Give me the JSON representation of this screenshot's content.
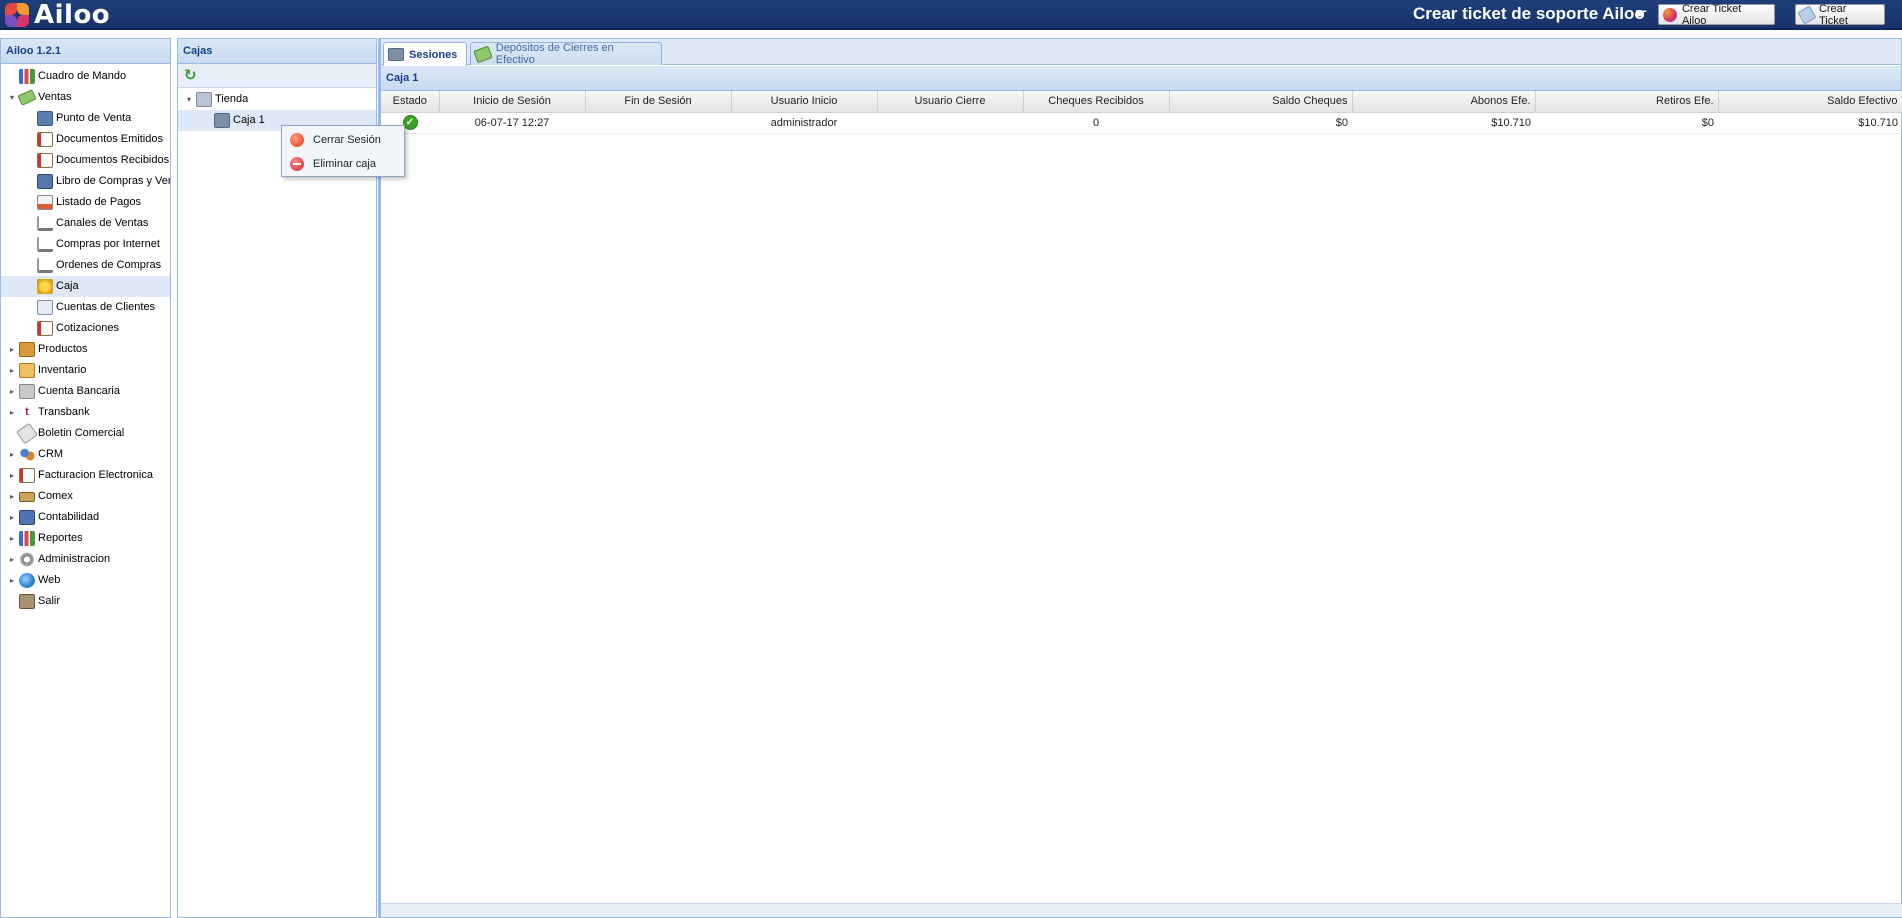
{
  "app": {
    "brand": "Ailoo"
  },
  "header": {
    "support_title": "Crear ticket de soporte Ailoo",
    "pointer_icon": "pointing-hand-icon",
    "btn_ticket_ailoo": "Crear Ticket Ailoo",
    "btn_ticket": "Crear Ticket"
  },
  "nav": {
    "title": "Ailoo 1.2.1",
    "items": [
      {
        "label": "Cuadro de Mando",
        "level": 0,
        "expander": "",
        "icon": "chart-icon"
      },
      {
        "label": "Ventas",
        "level": 0,
        "expander": "▾",
        "icon": "money-icon"
      },
      {
        "label": "Punto de Venta",
        "level": 1,
        "expander": "",
        "icon": "pos-icon"
      },
      {
        "label": "Documentos Emitidos",
        "level": 1,
        "expander": "",
        "icon": "document-icon"
      },
      {
        "label": "Documentos Recibidos",
        "level": 1,
        "expander": "",
        "icon": "document-icon"
      },
      {
        "label": "Libro de Compras y Ventas",
        "level": 1,
        "expander": "",
        "icon": "book-icon"
      },
      {
        "label": "Listado de Pagos",
        "level": 1,
        "expander": "",
        "icon": "payment-list-icon"
      },
      {
        "label": "Canales de Ventas",
        "level": 1,
        "expander": "",
        "icon": "cart-icon"
      },
      {
        "label": "Compras por Internet",
        "level": 1,
        "expander": "",
        "icon": "cart-icon"
      },
      {
        "label": "Ordenes de Compras",
        "level": 1,
        "expander": "",
        "icon": "cart-icon"
      },
      {
        "label": "Caja",
        "level": 1,
        "expander": "",
        "icon": "coins-icon",
        "selected": true
      },
      {
        "label": "Cuentas de Clientes",
        "level": 1,
        "expander": "",
        "icon": "client-card-icon"
      },
      {
        "label": "Cotizaciones",
        "level": 1,
        "expander": "",
        "icon": "document-icon"
      },
      {
        "label": "Productos",
        "level": 0,
        "expander": "▸",
        "icon": "box-icon"
      },
      {
        "label": "Inventario",
        "level": 0,
        "expander": "▸",
        "icon": "package-icon"
      },
      {
        "label": "Cuenta Bancaria",
        "level": 0,
        "expander": "▸",
        "icon": "bank-icon"
      },
      {
        "label": "Transbank",
        "level": 0,
        "expander": "▸",
        "icon": "transbank-icon"
      },
      {
        "label": "Boletin Comercial",
        "level": 0,
        "expander": "",
        "icon": "tag-icon"
      },
      {
        "label": "CRM",
        "level": 0,
        "expander": "▸",
        "icon": "users-icon"
      },
      {
        "label": "Facturacion Electronica",
        "level": 0,
        "expander": "▸",
        "icon": "invoice-icon"
      },
      {
        "label": "Comex",
        "level": 0,
        "expander": "▸",
        "icon": "truck-icon"
      },
      {
        "label": "Contabilidad",
        "level": 0,
        "expander": "▸",
        "icon": "ledger-icon"
      },
      {
        "label": "Reportes",
        "level": 0,
        "expander": "▸",
        "icon": "chart-icon"
      },
      {
        "label": "Administracion",
        "level": 0,
        "expander": "▸",
        "icon": "gear-icon"
      },
      {
        "label": "Web",
        "level": 0,
        "expander": "▸",
        "icon": "globe-icon"
      },
      {
        "label": "Salir",
        "level": 0,
        "expander": "",
        "icon": "exit-icon"
      }
    ]
  },
  "cajas": {
    "title": "Cajas",
    "refresh_icon": "refresh-icon",
    "tree": [
      {
        "label": "Tienda",
        "level": 0,
        "expander": "▾",
        "icon": "building-icon"
      },
      {
        "label": "Caja 1",
        "level": 1,
        "expander": "",
        "icon": "register-icon",
        "selected": true
      }
    ]
  },
  "context_menu": {
    "items": [
      {
        "label": "Cerrar Sesión",
        "icon": "close-session-icon"
      },
      {
        "label": "Eliminar caja",
        "icon": "delete-icon"
      }
    ]
  },
  "tabs": [
    {
      "label": "Sesiones",
      "active": true,
      "icon": "register-icon"
    },
    {
      "label": "Depósitos de Cierres en Efectivo",
      "active": false,
      "icon": "money-icon"
    }
  ],
  "grid": {
    "title": "Caja 1",
    "columns": [
      "Estado",
      "Inicio de Sesión",
      "Fin de Sesión",
      "Usuario Inicio",
      "Usuario Cierre",
      "Cheques Recibidos",
      "Saldo Cheques",
      "Abonos Efe.",
      "Retiros Efe.",
      "Saldo Efectivo"
    ],
    "rows": [
      {
        "estado_icon": "ok-check-icon",
        "inicio": "06-07-17 12:27",
        "fin": "",
        "usuario_inicio": "administrador",
        "usuario_cierre": "",
        "cheques_recibidos": "0",
        "saldo_cheques": "$0",
        "abonos": "$10.710",
        "retiros": "$0",
        "saldo_efectivo": "$10.710"
      }
    ]
  },
  "colors": {
    "header_bg": "#1f3f7c",
    "panel_border": "#99bbe8",
    "panel_title": "#15428b",
    "selected_row": "#dfe8f6"
  }
}
